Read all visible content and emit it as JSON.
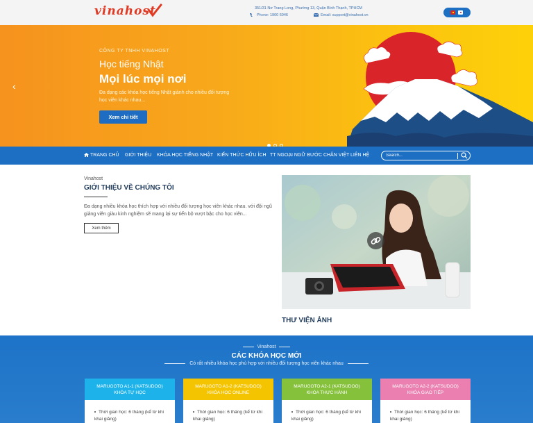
{
  "header": {
    "logo_text": "vinahost",
    "address": "351/31 Nơ Trang Long, Phường 13, Quận Bình Thạnh, TPHCM",
    "phone": "Phone: 1900 6046",
    "email": "Email: support@vinahost.vn",
    "languages": [
      "vn-flag",
      "jp-flag"
    ]
  },
  "hero": {
    "company": "CÔNG TY TNHH VINAHOST",
    "title_line1": "Học tiếng Nhật",
    "title_line2": "Mọi lúc mọi nơi",
    "description": "Đa dạng các khóa học tiếng Nhật giành cho nhiều đối tượng học viên khác nhau...",
    "button": "Xem chi tiết",
    "slides": 3,
    "active_slide": 1,
    "prev_icon": "chevron-left-icon"
  },
  "nav": {
    "items": [
      "TRANG CHỦ",
      "GIỚI THIỆU",
      "KHÓA HỌC TIẾNG NHẬT",
      "KIẾN THỨC HỮU ÍCH",
      "TT NGOẠI NGỮ BƯỚC CHÂN VIỆT",
      "LIÊN HỆ"
    ],
    "search_placeholder": "Search..."
  },
  "intro": {
    "kicker": "Vinahost",
    "title": "GIỚI THIỆU VỀ CHÚNG TÔI",
    "text": "Đa dạng nhiều khóa học thích hợp với nhiều đối tượng học viên khác nhau. với đội ngũ giảng viên giàu kinh nghiệm sẽ mang lại sự tiến bộ vượt bậc cho học viên...",
    "button": "Xem thêm"
  },
  "gallery": {
    "title": "THƯ VIỆN ẢNH"
  },
  "courses": {
    "kicker": "Vinahost",
    "title": "CÁC KHÓA HỌC MỚI",
    "subtitle": "Có rất nhiều khóa học phù hợp với nhiều đối tượng học viên khác nhau",
    "cards": [
      {
        "name": "MARUGOTO A1-1 (KATSUDOO)",
        "type": "KHÓA TỰ HỌC",
        "detail": "Thời gian học: 6 tháng (kể từ khi",
        "detail2": "khai giảng)",
        "color": "#1db3ea"
      },
      {
        "name": "MARUGOTO A1-2 (KATSUDOO)",
        "type": "KHÓA HỌC ONLINE",
        "detail": "Thời gian học: 6 tháng (kể từ khi",
        "detail2": "khai giảng)",
        "color": "#f5c400"
      },
      {
        "name": "MARUGOTO A2-1 (KATSUDOO)",
        "type": "KHÓA THỰC HÀNH",
        "detail": "Thời gian học: 6 tháng (kể từ khi",
        "detail2": "khai giảng)",
        "color": "#86c13c"
      },
      {
        "name": "MARUGOTO A2-2 (KATSUDOO)",
        "type": "KHÓA GIAO TIẾP",
        "detail": "Thời gian học: 6 tháng (kể từ khi",
        "detail2": "khai giảng)",
        "color": "#ea7fb0"
      }
    ]
  },
  "colors": {
    "brand_blue": "#1d6fc4",
    "logo_red": "#e03a25",
    "hero_orange": "#f6921e",
    "hero_yellow": "#fdd10a"
  }
}
